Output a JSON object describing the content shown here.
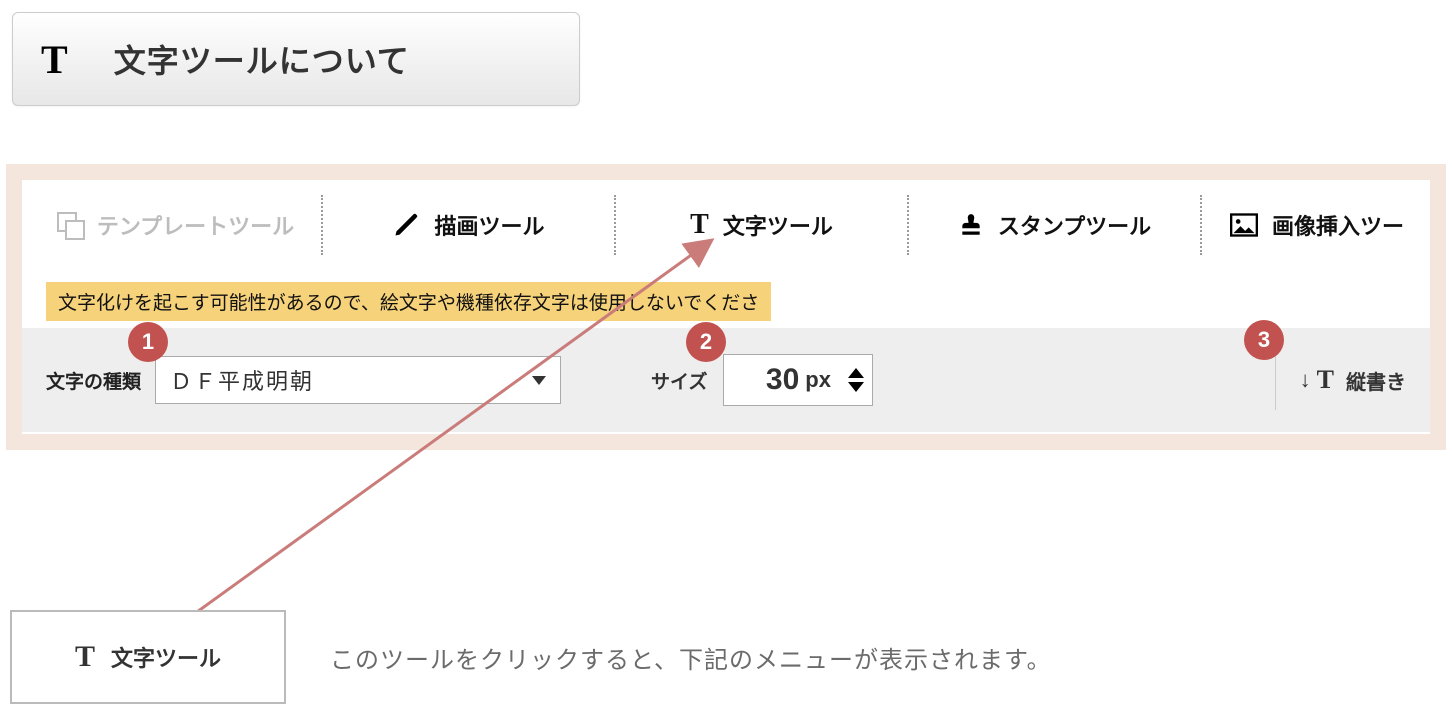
{
  "header": {
    "title": "文字ツールについて"
  },
  "tabs": {
    "template": "テンプレートツール",
    "draw": "描画ツール",
    "text": "文字ツール",
    "stamp": "スタンプツール",
    "image": "画像挿入ツー"
  },
  "warning": "文字化けを起こす可能性があるので、絵文字や機種依存文字は使用しないでくださ",
  "settings": {
    "font_label": "文字の種類",
    "font_value": "ＤＦ平成明朝",
    "size_label": "サイズ",
    "size_value": "30",
    "size_unit": "px",
    "vertical_label": "縦書き"
  },
  "badges": {
    "b1": "1",
    "b2": "2",
    "b3": "3"
  },
  "callout": {
    "label": "文字ツール",
    "desc": "このツールをクリックすると、下記のメニューが表示されます。"
  }
}
